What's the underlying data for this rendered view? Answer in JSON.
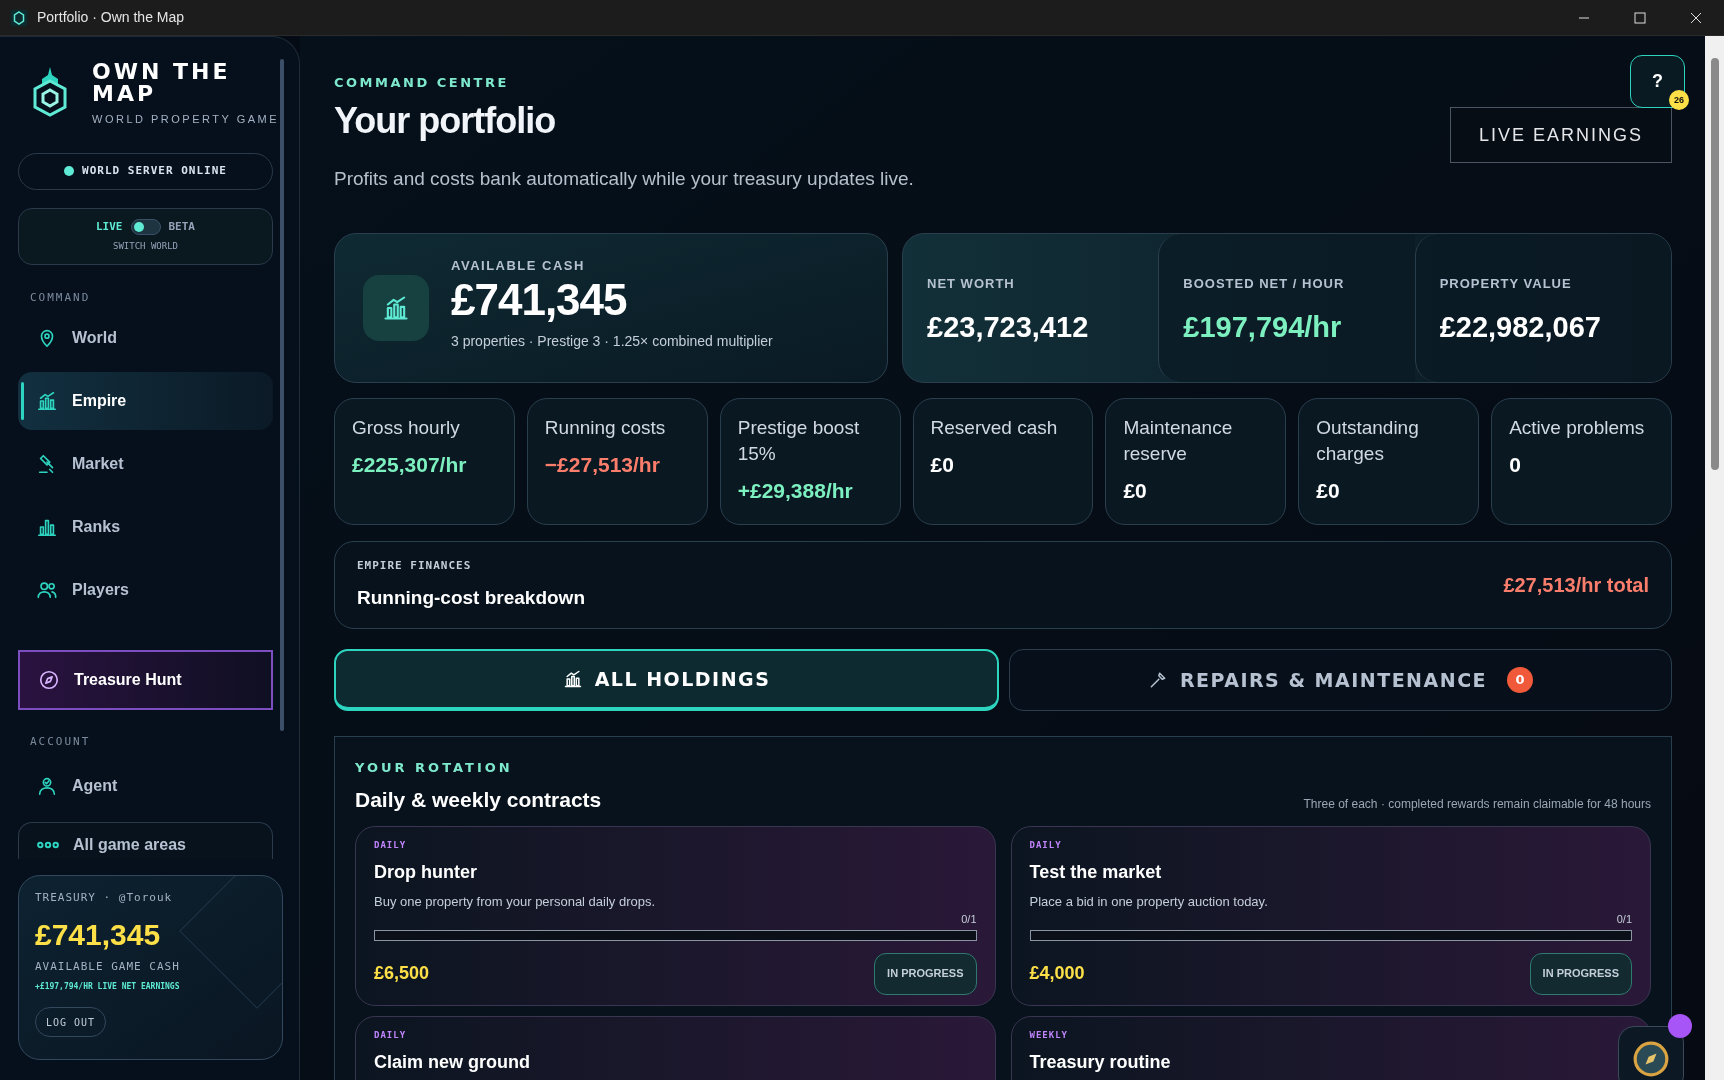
{
  "window": {
    "title": "Portfolio · Own the Map"
  },
  "sidebar": {
    "brand": {
      "name": "OWN THE MAP",
      "tagline": "WORLD PROPERTY GAME"
    },
    "server_status": {
      "label": "WORLD SERVER ONLINE",
      "online": true
    },
    "world_switch": {
      "live_label": "LIVE",
      "beta_label": "BETA",
      "caption": "SWITCH WORLD",
      "beta": false
    },
    "sections": [
      {
        "heading": "COMMAND",
        "items": [
          {
            "label": "World",
            "selected": false
          },
          {
            "label": "Empire",
            "selected": true
          },
          {
            "label": "Market",
            "selected": false
          },
          {
            "label": "Ranks",
            "selected": false
          },
          {
            "label": "Players",
            "selected": false
          },
          {
            "label": "Treasure Hunt",
            "selected": false,
            "kind": "featured"
          }
        ]
      },
      {
        "heading": "ACCOUNT",
        "items": [
          {
            "label": "Agent",
            "selected": false
          },
          {
            "label": "All game areas",
            "selected": false,
            "kind": "boxed"
          }
        ]
      }
    ],
    "treasury": {
      "label": "TREASURY · @Torouk",
      "amount": "£741,345",
      "caption": "AVAILABLE GAME CASH",
      "earnings": "+£197,794/HR LIVE NET EARNINGS",
      "logout": "LOG OUT"
    }
  },
  "header": {
    "eyebrow": "COMMAND CENTRE",
    "title": "Your portfolio",
    "subtitle": "Profits and costs bank automatically while your treasury updates live.",
    "help_button": "?",
    "help_badge": "26",
    "live_button": "LIVE EARNINGS"
  },
  "cash_card": {
    "label": "AVAILABLE CASH",
    "amount": "£741,345",
    "detail": "3 properties · Prestige 3 · 1.25× combined multiplier"
  },
  "summary": [
    {
      "label": "NET WORTH",
      "value": "£23,723,412",
      "kind": "neutral"
    },
    {
      "label": "BOOSTED NET / HOUR",
      "value": "£197,794/hr",
      "kind": "positive"
    },
    {
      "label": "PROPERTY VALUE",
      "value": "£22,982,067",
      "kind": "neutral"
    }
  ],
  "stats": [
    {
      "label": "Gross hourly",
      "value": "£225,307/hr",
      "kind": "positive"
    },
    {
      "label": "Running costs",
      "value": "−£27,513/hr",
      "kind": "negative"
    },
    {
      "label": "Prestige boost 15%",
      "value": "+£29,388/hr",
      "kind": "positive"
    },
    {
      "label": "Reserved cash",
      "value": "£0",
      "kind": "neutral"
    },
    {
      "label": "Maintenance reserve",
      "value": "£0",
      "kind": "neutral"
    },
    {
      "label": "Outstanding charges",
      "value": "£0",
      "kind": "neutral"
    },
    {
      "label": "Active problems",
      "value": "0",
      "kind": "neutral"
    }
  ],
  "finances": {
    "eyebrow": "EMPIRE FINANCES",
    "title": "Running-cost breakdown",
    "total": "£27,513/hr total"
  },
  "tabs": [
    {
      "label": "ALL HOLDINGS",
      "selected": true
    },
    {
      "label": "REPAIRS & MAINTENANCE",
      "selected": false,
      "badge": "0"
    }
  ],
  "contracts": {
    "eyebrow": "YOUR ROTATION",
    "title": "Daily & weekly contracts",
    "note": "Three of each · completed rewards remain claimable for 48 hours",
    "items": [
      {
        "period": "DAILY",
        "title": "Drop hunter",
        "description": "Buy one property from your personal daily drops.",
        "progress": "0/1",
        "level": 0,
        "reward": "£6,500",
        "status": "IN PROGRESS"
      },
      {
        "period": "DAILY",
        "title": "Test the market",
        "description": "Place a bid in one property auction today.",
        "progress": "0/1",
        "level": 0,
        "reward": "£4,000",
        "status": "IN PROGRESS"
      },
      {
        "period": "DAILY",
        "title": "Claim new ground"
      },
      {
        "period": "WEEKLY",
        "title": "Treasury routine"
      }
    ]
  }
}
